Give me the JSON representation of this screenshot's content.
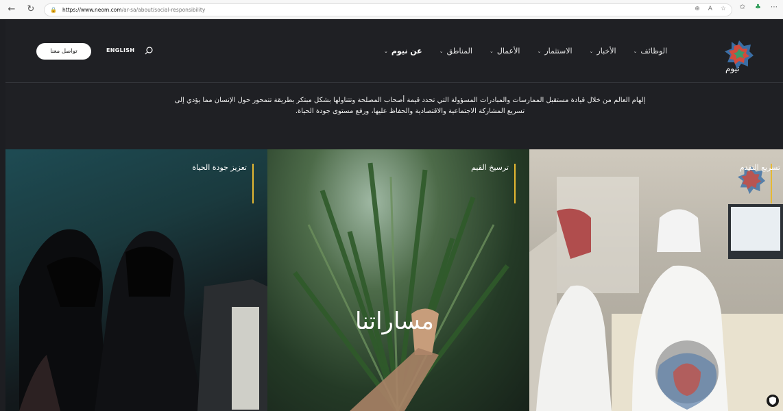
{
  "browser": {
    "url_host": "https://www.neom.com",
    "url_path": "/ar-sa/about/social-responsibility"
  },
  "header": {
    "contact_label": "تواصل معنا",
    "lang_label": "ENGLISH",
    "logo_text": "نيوم",
    "menu": [
      {
        "label": "عن نيوم"
      },
      {
        "label": "المناطق"
      },
      {
        "label": "الأعمال"
      },
      {
        "label": "الاستثمار"
      },
      {
        "label": "الأخبار"
      },
      {
        "label": "الوظائف"
      }
    ]
  },
  "intro": {
    "line1": "إلهام العالم من خلال قيادة مستقبل الممارسات والمبادرات المسؤولة التي تحدد قيمة أصحاب المصلحة وتتناولها بشكل مبتكر بطريقة تتمحور حول الإنسان مما يؤدي إلى",
    "line2": "تسريع المشاركة الاجتماعية والاقتصادية والحفاظ عليها، ورفع مستوى جودة الحياة."
  },
  "panels": [
    {
      "title": "تعزيز جودة الحياة"
    },
    {
      "title": "ترسيخ القيم"
    },
    {
      "title": "تسريع التقدم"
    }
  ],
  "center_title": "مساراتنا",
  "colors": {
    "accent": "#e6b932",
    "background": "#1f2024"
  }
}
